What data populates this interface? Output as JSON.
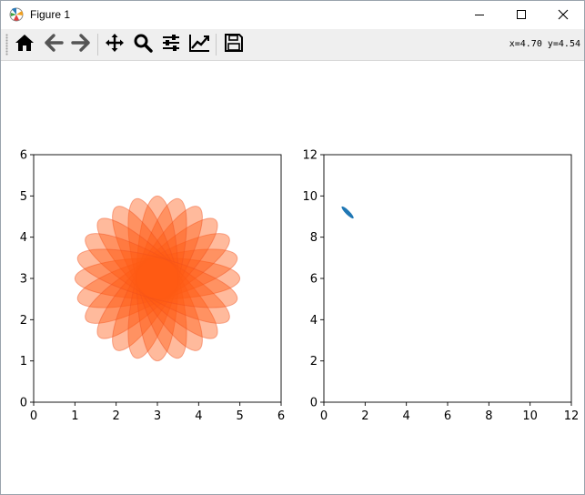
{
  "window": {
    "title": "Figure 1",
    "app_icon": "matplotlib-icon",
    "controls": {
      "minimize": "minimize-icon",
      "maximize": "maximize-icon",
      "close": "close-icon"
    }
  },
  "toolbar": {
    "buttons": [
      {
        "name": "home",
        "icon": "home-icon"
      },
      {
        "name": "back",
        "icon": "arrow-left-icon"
      },
      {
        "name": "forward",
        "icon": "arrow-right-icon"
      },
      {
        "name": "pan",
        "icon": "move-icon"
      },
      {
        "name": "zoom",
        "icon": "magnifier-icon"
      },
      {
        "name": "configure-subplots",
        "icon": "sliders-icon"
      },
      {
        "name": "edit-axes",
        "icon": "line-chart-icon"
      },
      {
        "name": "save",
        "icon": "floppy-disk-icon"
      }
    ],
    "coords": "x=4.70 y=4.54"
  },
  "colors": {
    "ellipse_fill": "#ff5a14",
    "ellipse_edge": "#f05020",
    "blue": "#1f77b4"
  },
  "chart_data": [
    {
      "type": "scatter",
      "description_of_marks": "12 ellipses centered at (3,3), width 4, height 1, rotated every 15 degrees, semi-transparent",
      "ellipses": {
        "center": [
          3,
          3
        ],
        "width": 4,
        "height": 1,
        "angles_deg": [
          0,
          15,
          30,
          45,
          60,
          75,
          90,
          105,
          120,
          135,
          150,
          165
        ],
        "alpha": 0.42
      },
      "xlim": [
        0,
        6
      ],
      "ylim": [
        0,
        6
      ],
      "xticks": [
        "0",
        "1",
        "2",
        "3",
        "4",
        "5",
        "6"
      ],
      "yticks": [
        "0",
        "1",
        "2",
        "3",
        "4",
        "5",
        "6"
      ]
    },
    {
      "type": "scatter",
      "ellipses": {
        "center": [
          1.15,
          9.2
        ],
        "width": 0.8,
        "height": 0.2,
        "angles_deg": [
          -45
        ],
        "alpha": 1
      },
      "xlim": [
        0,
        12
      ],
      "ylim": [
        0,
        12
      ],
      "xticks": [
        "0",
        "2",
        "4",
        "6",
        "8",
        "10",
        "12"
      ],
      "yticks": [
        "0",
        "2",
        "4",
        "6",
        "8",
        "10",
        "12"
      ]
    }
  ]
}
